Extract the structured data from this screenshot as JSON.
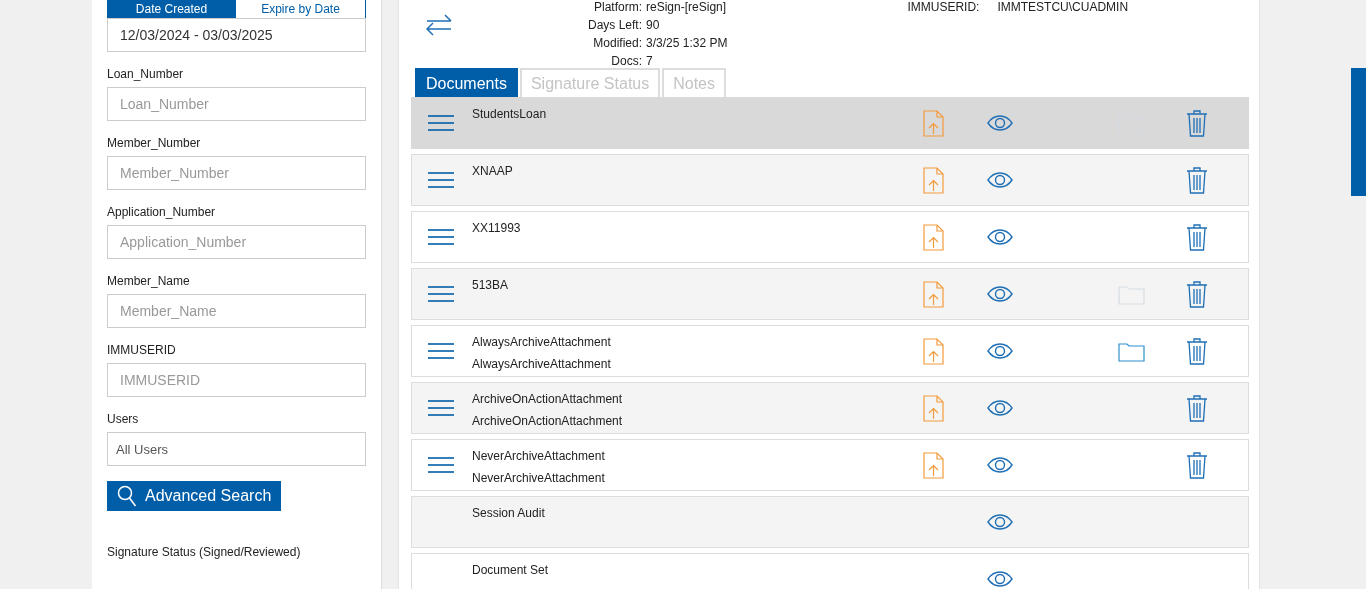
{
  "date_tabs": [
    {
      "label": "Date Created",
      "selected": true
    },
    {
      "label": "Expire by Date",
      "selected": false
    }
  ],
  "date_range": {
    "value": "12/03/2024 - 03/03/2025"
  },
  "filters": [
    {
      "label": "Loan_Number",
      "placeholder": "Loan_Number"
    },
    {
      "label": "Member_Number",
      "placeholder": "Member_Number"
    },
    {
      "label": "Application_Number",
      "placeholder": "Application_Number"
    },
    {
      "label": "Member_Name",
      "placeholder": "Member_Name"
    },
    {
      "label": "IMMUSERID",
      "placeholder": "IMMUSERID"
    }
  ],
  "users": {
    "label": "Users",
    "value": "All Users"
  },
  "search_button": "Advanced Search",
  "signature_status_label": "Signature Status (Signed/Reviewed)",
  "info": [
    {
      "label": "Platform:",
      "value": "reSign-[reSign]"
    },
    {
      "label": "Days Left:",
      "value": "90"
    },
    {
      "label": "Modified:",
      "value": "3/3/25 1:32 PM"
    },
    {
      "label": "Docs:",
      "value": "7"
    }
  ],
  "info_right": {
    "label": "IMMUSERID:",
    "value": "IMMTESTCU\\CUADMIN"
  },
  "tabs": [
    {
      "label": "Documents",
      "selected": true
    },
    {
      "label": "Signature Status",
      "selected": false
    },
    {
      "label": "Notes",
      "selected": false
    }
  ],
  "documents": [
    {
      "kind": "document",
      "title": "StudentsLoan",
      "selected": true,
      "folder": true,
      "folder_disabled": true
    },
    {
      "kind": "document",
      "title": "XNAAP",
      "selected": false,
      "folder": false
    },
    {
      "kind": "document",
      "title": "XX11993",
      "selected": false,
      "folder": false
    },
    {
      "kind": "document",
      "title": "513BA",
      "selected": false,
      "folder": true,
      "folder_disabled": true
    },
    {
      "kind": "document",
      "title": "AlwaysArchiveAttachment",
      "subtitle": "AlwaysArchiveAttachment",
      "selected": false,
      "folder": true,
      "folder_disabled": false
    },
    {
      "kind": "document",
      "title": "ArchiveOnActionAttachment",
      "subtitle": "ArchiveOnActionAttachment",
      "selected": false,
      "folder": false
    },
    {
      "kind": "document",
      "title": "NeverArchiveAttachment",
      "subtitle": "NeverArchiveAttachment",
      "selected": false,
      "folder": false
    },
    {
      "kind": "audit",
      "title": "Session Audit",
      "selected": false,
      "folder": false
    },
    {
      "kind": "audit",
      "title": "Document Set",
      "selected": false,
      "folder": false
    }
  ]
}
